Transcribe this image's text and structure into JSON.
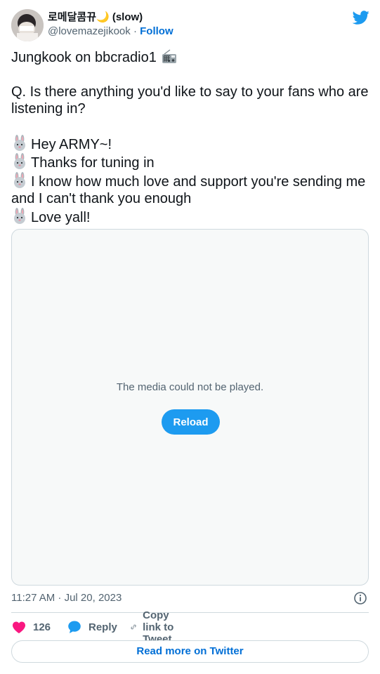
{
  "author": {
    "display_name": "로메달콤뀨🌙 (slow)",
    "handle": "@lovemazejikook",
    "separator": " · ",
    "follow_label": "Follow"
  },
  "tweet": {
    "line1": "Jungkook on bbcradio1",
    "line2": "Q. Is there anything you'd like to say to your fans who are listening in?",
    "line3": "Hey ARMY~!",
    "line4": "Thanks for tuning in",
    "line5": "I know how much love and support you're sending me and I can't thank you enough",
    "line6": "Love yall!"
  },
  "media": {
    "message": "The media could not be played.",
    "reload_label": "Reload"
  },
  "meta": {
    "timestamp": "11:27 AM · Jul 20, 2023"
  },
  "actions": {
    "like_count": "126",
    "reply_label": "Reply",
    "copy_label": "Copy link to Tweet"
  },
  "footer": {
    "read_more_label": "Read more on Twitter"
  },
  "colors": {
    "brand_blue": "#1d9bf0",
    "link_blue": "#006fd6",
    "heart": "#f91880",
    "muted": "#536471"
  },
  "icons": [
    "twitter-bird-icon",
    "radio-emoji",
    "rabbit-emoji",
    "info-icon",
    "heart-icon",
    "reply-bubble-icon",
    "link-icon"
  ]
}
